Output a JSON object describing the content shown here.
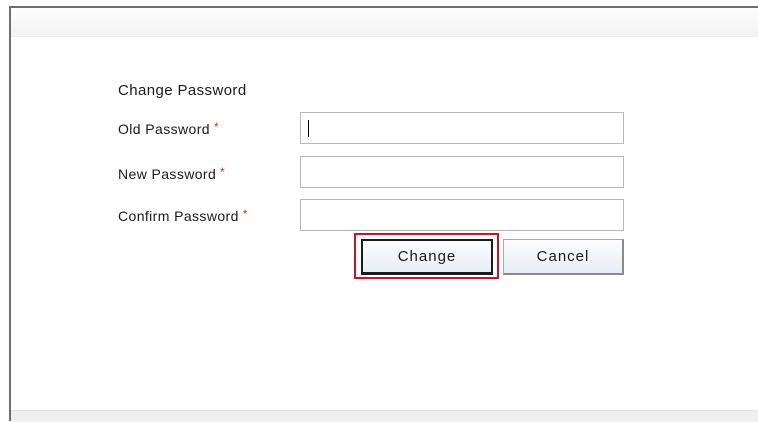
{
  "form": {
    "title": "Change Password",
    "fields": [
      {
        "label": "Old Password",
        "required_mark": "*",
        "value": "",
        "focused": true
      },
      {
        "label": "New Password",
        "required_mark": "*",
        "value": ""
      },
      {
        "label": "Confirm Password",
        "required_mark": "*",
        "value": ""
      }
    ],
    "buttons": {
      "change_label": "Change",
      "cancel_label": "Cancel"
    }
  },
  "colors": {
    "required_marker": "#c0392b",
    "highlight_border": "#c0172b",
    "button_fill": "#e8edf5"
  }
}
